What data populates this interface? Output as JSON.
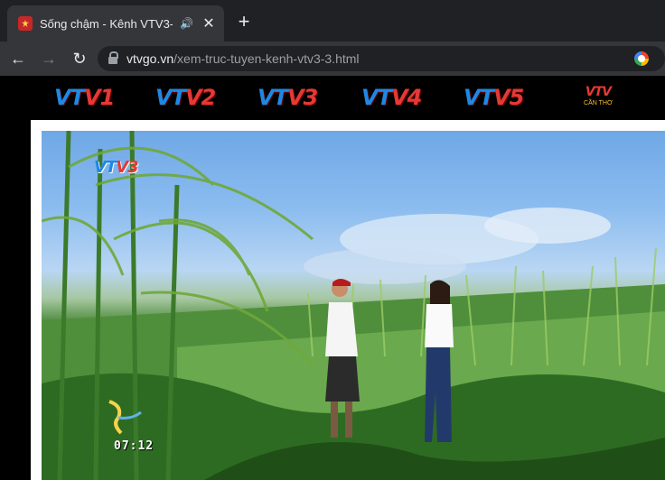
{
  "browser": {
    "tab_title": "Sống chậm - Kênh VTV3-",
    "audio_icon": "speaker-icon",
    "close_glyph": "✕",
    "newtab_glyph": "+",
    "url_host": "vtvgo.vn",
    "url_path": "/xem-truc-tuyen-kenh-vtv3-3.html",
    "back_glyph": "←",
    "forward_glyph": "→",
    "reload_glyph": "↻"
  },
  "channels": [
    {
      "prefix": "VT",
      "suffix": "V1"
    },
    {
      "prefix": "VT",
      "suffix": "V2"
    },
    {
      "prefix": "VT",
      "suffix": "V3"
    },
    {
      "prefix": "VT",
      "suffix": "V4"
    },
    {
      "prefix": "VT",
      "suffix": "V5"
    }
  ],
  "channel_extra": {
    "logo": "VTV",
    "subtitle": "CẦN THƠ"
  },
  "player": {
    "watermark_prefix": "VT",
    "watermark_suffix": "V3",
    "clock": "07:12"
  },
  "colors": {
    "tab_bg": "#35363a",
    "toolbar_bg": "#35363a",
    "omnibox_bg": "#202124",
    "vtv_red": "#e53935",
    "vtv_blue": "#1e88e5",
    "vtv_green": "#43a047"
  }
}
